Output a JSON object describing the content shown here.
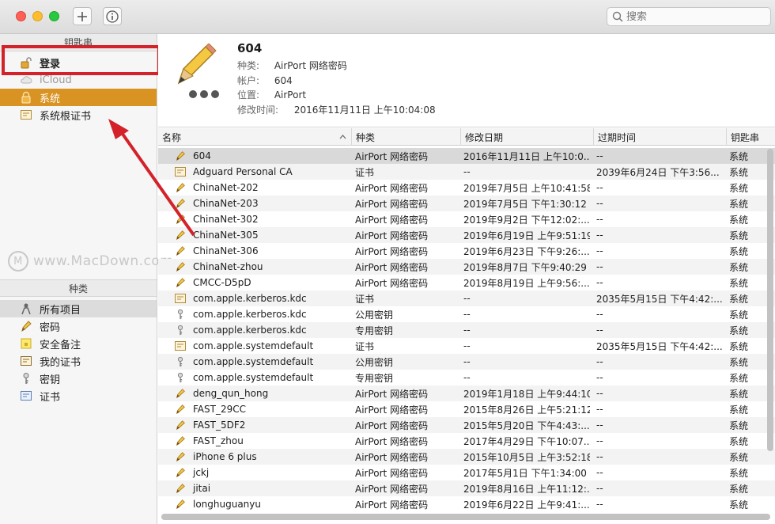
{
  "toolbar": {
    "search_placeholder": "搜索"
  },
  "sidebar": {
    "keychains_header": "钥匙串",
    "keychains": [
      {
        "label": "登录",
        "icon": "unlocked-padlock-icon"
      },
      {
        "label": "iCloud",
        "icon": "cloud-icon"
      },
      {
        "label": "系统",
        "icon": "padlock-icon"
      },
      {
        "label": "系统根证书",
        "icon": "certificate-icon"
      }
    ],
    "categories_header": "种类",
    "categories": [
      {
        "label": "所有项目",
        "icon": "people-icon"
      },
      {
        "label": "密码",
        "icon": "pencil-icon"
      },
      {
        "label": "安全备注",
        "icon": "note-icon"
      },
      {
        "label": "我的证书",
        "icon": "my-certificate-icon"
      },
      {
        "label": "密钥",
        "icon": "key-icon"
      },
      {
        "label": "证书",
        "icon": "certificate-icon"
      }
    ]
  },
  "watermark": {
    "text": "www.MacDown.com",
    "logo": "M"
  },
  "detail": {
    "title": "604",
    "kind_label": "种类:",
    "kind_value": "AirPort 网络密码",
    "account_label": "帐户:",
    "account_value": "604",
    "where_label": "位置:",
    "where_value": "AirPort",
    "modified_label": "修改时间:",
    "modified_value": "2016年11月11日 上午10:04:08"
  },
  "table": {
    "columns": {
      "name": "名称",
      "kind": "种类",
      "modified": "修改日期",
      "expires": "过期时间",
      "keychain": "钥匙串"
    },
    "rows": [
      {
        "icon": "pencil-icon",
        "name": "604",
        "kind": "AirPort 网络密码",
        "modified": "2016年11月11日 上午10:0...",
        "expires": "--",
        "keychain": "系统"
      },
      {
        "icon": "certificate-icon",
        "name": "Adguard Personal CA",
        "kind": "证书",
        "modified": "--",
        "expires": "2039年6月24日 下午3:56...",
        "keychain": "系统"
      },
      {
        "icon": "pencil-icon",
        "name": "ChinaNet-202",
        "kind": "AirPort 网络密码",
        "modified": "2019年7月5日 上午10:41:58",
        "expires": "--",
        "keychain": "系统"
      },
      {
        "icon": "pencil-icon",
        "name": "ChinaNet-203",
        "kind": "AirPort 网络密码",
        "modified": "2019年7月5日 下午1:30:12",
        "expires": "--",
        "keychain": "系统"
      },
      {
        "icon": "pencil-icon",
        "name": "ChinaNet-302",
        "kind": "AirPort 网络密码",
        "modified": "2019年9月2日 下午12:02:...",
        "expires": "--",
        "keychain": "系统"
      },
      {
        "icon": "pencil-icon",
        "name": "ChinaNet-305",
        "kind": "AirPort 网络密码",
        "modified": "2019年6月19日 上午9:51:19",
        "expires": "--",
        "keychain": "系统"
      },
      {
        "icon": "pencil-icon",
        "name": "ChinaNet-306",
        "kind": "AirPort 网络密码",
        "modified": "2019年6月23日 下午9:26:...",
        "expires": "--",
        "keychain": "系统"
      },
      {
        "icon": "pencil-icon",
        "name": "ChinaNet-zhou",
        "kind": "AirPort 网络密码",
        "modified": "2019年8月7日 下午9:40:29",
        "expires": "--",
        "keychain": "系统"
      },
      {
        "icon": "pencil-icon",
        "name": "CMCC-D5pD",
        "kind": "AirPort 网络密码",
        "modified": "2019年8月19日 上午9:56:...",
        "expires": "--",
        "keychain": "系统"
      },
      {
        "icon": "certificate-icon",
        "name": "com.apple.kerberos.kdc",
        "kind": "证书",
        "modified": "--",
        "expires": "2035年5月15日 下午4:42:...",
        "keychain": "系统"
      },
      {
        "icon": "key-icon",
        "name": "com.apple.kerberos.kdc",
        "kind": "公用密钥",
        "modified": "--",
        "expires": "--",
        "keychain": "系统"
      },
      {
        "icon": "key-icon",
        "name": "com.apple.kerberos.kdc",
        "kind": "专用密钥",
        "modified": "--",
        "expires": "--",
        "keychain": "系统"
      },
      {
        "icon": "certificate-icon",
        "name": "com.apple.systemdefault",
        "kind": "证书",
        "modified": "--",
        "expires": "2035年5月15日 下午4:42:...",
        "keychain": "系统"
      },
      {
        "icon": "key-icon",
        "name": "com.apple.systemdefault",
        "kind": "公用密钥",
        "modified": "--",
        "expires": "--",
        "keychain": "系统"
      },
      {
        "icon": "key-icon",
        "name": "com.apple.systemdefault",
        "kind": "专用密钥",
        "modified": "--",
        "expires": "--",
        "keychain": "系统"
      },
      {
        "icon": "pencil-icon",
        "name": "deng_qun_hong",
        "kind": "AirPort 网络密码",
        "modified": "2019年1月18日 上午9:44:10",
        "expires": "--",
        "keychain": "系统"
      },
      {
        "icon": "pencil-icon",
        "name": "FAST_29CC",
        "kind": "AirPort 网络密码",
        "modified": "2015年8月26日 上午5:21:12",
        "expires": "--",
        "keychain": "系统"
      },
      {
        "icon": "pencil-icon",
        "name": "FAST_5DF2",
        "kind": "AirPort 网络密码",
        "modified": "2015年5月20日 下午4:43:...",
        "expires": "--",
        "keychain": "系统"
      },
      {
        "icon": "pencil-icon",
        "name": "FAST_zhou",
        "kind": "AirPort 网络密码",
        "modified": "2017年4月29日 下午10:07...",
        "expires": "--",
        "keychain": "系统"
      },
      {
        "icon": "pencil-icon",
        "name": "iPhone 6 plus",
        "kind": "AirPort 网络密码",
        "modified": "2015年10月5日 上午3:52:18",
        "expires": "--",
        "keychain": "系统"
      },
      {
        "icon": "pencil-icon",
        "name": "jckj",
        "kind": "AirPort 网络密码",
        "modified": "2017年5月1日 下午1:34:00",
        "expires": "--",
        "keychain": "系统"
      },
      {
        "icon": "pencil-icon",
        "name": "jitai",
        "kind": "AirPort 网络密码",
        "modified": "2019年8月16日 上午11:12:...",
        "expires": "--",
        "keychain": "系统"
      },
      {
        "icon": "pencil-icon",
        "name": "longhuguanyu",
        "kind": "AirPort 网络密码",
        "modified": "2019年6月22日 上午9:41:...",
        "expires": "--",
        "keychain": "系统"
      }
    ]
  },
  "colors": {
    "selection": "#d99323",
    "highlight": "#d3222a"
  }
}
